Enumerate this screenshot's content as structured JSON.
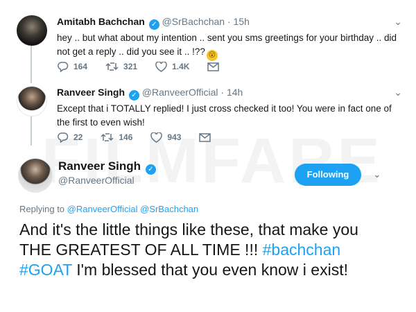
{
  "tweet1": {
    "name": "Amitabh Bachchan",
    "handle": "@SrBachchan",
    "dot": "·",
    "time": "15h",
    "text": "hey .. but what about my intention .. sent you sms greetings for your birthday .. did not get a reply .. did you see it .. !??",
    "emoji": "😮",
    "replies": "164",
    "retweets": "321",
    "likes": "1.4K"
  },
  "tweet2": {
    "name": "Ranveer Singh",
    "handle": "@RanveerOfficial",
    "dot": "·",
    "time": "14h",
    "text": "Except that i TOTALLY replied! I just cross checked it too! You were in fact one of the first to even wish!",
    "replies": "22",
    "retweets": "146",
    "likes": "943"
  },
  "focus": {
    "name": "Ranveer Singh",
    "handle": "@RanveerOfficial",
    "follow_label": "Following",
    "replying_prefix": "Replying to",
    "replying_to": "@RanveerOfficial @SrBachchan",
    "text_part1": "And it's the little things like these, that make you THE GREATEST OF ALL TIME !!!",
    "hashtags": "#bachchan #GOAT",
    "text_part2": "I'm blessed that you even know i exist!"
  },
  "watermark": "FILMFARE",
  "colors": {
    "accent": "#1da1f2",
    "muted": "#657786",
    "text": "#14171a"
  },
  "icons": {
    "reply": "reply-icon",
    "retweet": "retweet-icon",
    "like": "heart-icon",
    "dm": "envelope-icon",
    "menu": "chevron-down-icon"
  }
}
